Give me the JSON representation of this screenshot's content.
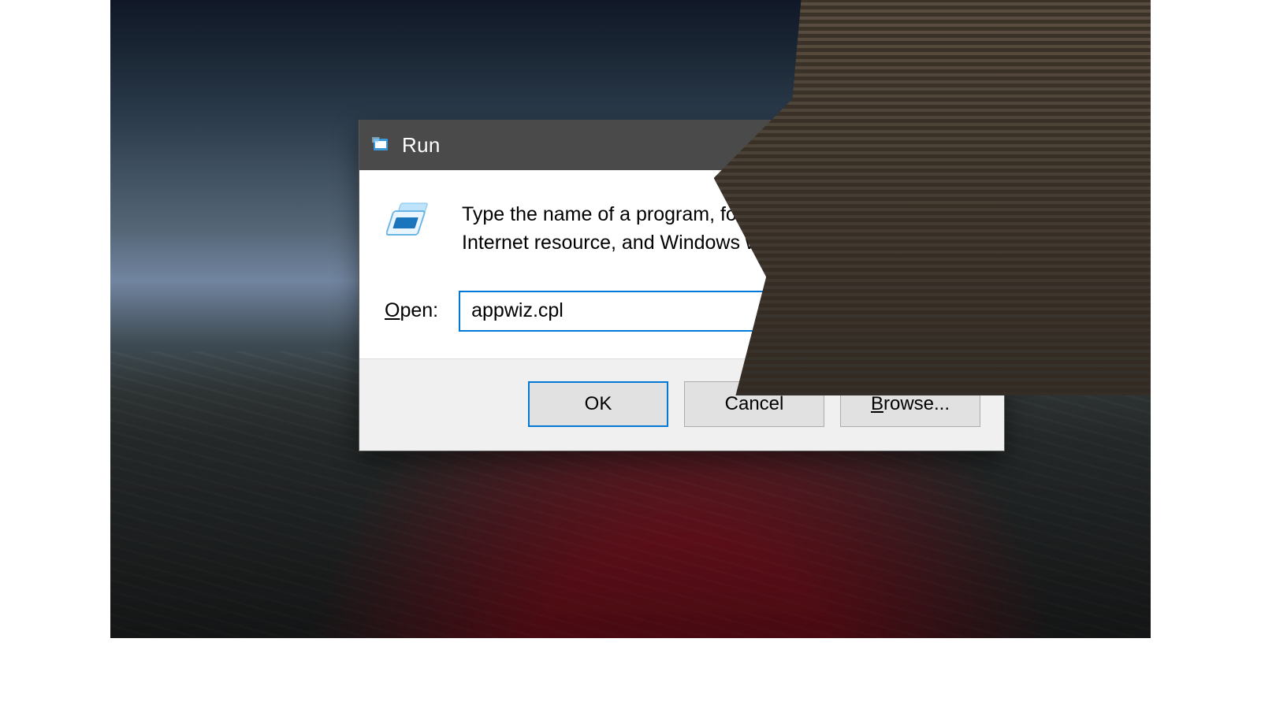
{
  "window": {
    "title": "Run",
    "icon": "run-icon",
    "close_icon": "close-icon"
  },
  "body": {
    "description": "Type the name of a program, folder, document, or Internet resource, and Windows will open it for you.",
    "open_label_pre": "O",
    "open_label_rest": "pen:",
    "input_value": "appwiz.cpl",
    "dropdown_icon": "chevron-down-icon"
  },
  "buttons": {
    "ok": "OK",
    "cancel": "Cancel",
    "browse_pre": "B",
    "browse_rest": "rowse..."
  },
  "colors": {
    "accent": "#0078d7",
    "titlebar": "#4a4a4a"
  }
}
